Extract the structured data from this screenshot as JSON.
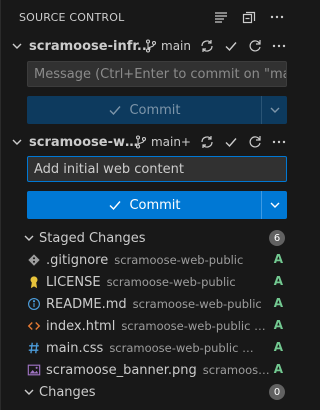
{
  "panel": {
    "title": "SOURCE CONTROL",
    "actions": [
      "list-view-icon",
      "collapse-all-icon",
      "more-icon"
    ]
  },
  "repos": [
    {
      "name": "scramoose-infr...",
      "branch": "main",
      "message_placeholder": "Message (Ctrl+Enter to commit on \"mai...",
      "commit_label": "Commit"
    },
    {
      "name": "scramoose-we...",
      "branch": "main+",
      "message_value": "Add initial web content",
      "commit_label": "Commit"
    }
  ],
  "staged": {
    "label": "Staged Changes",
    "count": "6",
    "files": [
      {
        "name": ".gitignore",
        "desc": "scramoose-web-public",
        "status": "A",
        "icon": "git-file-icon",
        "icon_color": "#9d9d9d"
      },
      {
        "name": "LICENSE",
        "desc": "scramoose-web-public",
        "status": "A",
        "icon": "license-icon",
        "icon_color": "#e8c33b"
      },
      {
        "name": "README.md",
        "desc": "scramoose-web-public",
        "status": "A",
        "icon": "info-icon",
        "icon_color": "#4c9ddb"
      },
      {
        "name": "index.html",
        "desc": "scramoose-web-public • src",
        "status": "A",
        "icon": "html-icon",
        "icon_color": "#e37933"
      },
      {
        "name": "main.css",
        "desc": "scramoose-web-public • src/css",
        "status": "A",
        "icon": "css-icon",
        "icon_color": "#4c9ddb"
      },
      {
        "name": "scramoose_banner.png",
        "desc": "scramoose-...",
        "status": "A",
        "icon": "image-icon",
        "icon_color": "#a074c4"
      }
    ]
  },
  "changes": {
    "label": "Changes",
    "count": "0"
  },
  "colors": {
    "accent": "#0078d4",
    "added": "#73c991",
    "background": "#181818"
  }
}
